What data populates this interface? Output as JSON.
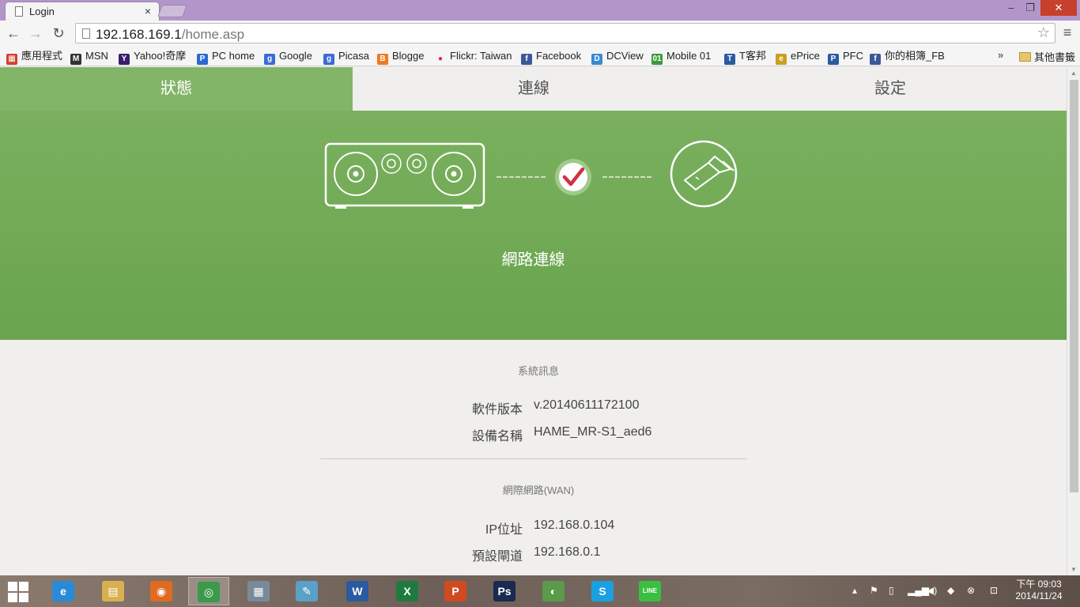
{
  "browser": {
    "tab_title": "Login",
    "tab_close": "×",
    "url_host": "192.168.169.1",
    "url_path": "/home.asp",
    "window_controls": {
      "minimize": "–",
      "restore": "❐",
      "close": "✕"
    },
    "nav": {
      "back": "←",
      "forward": "→",
      "reload": "↻",
      "star": "☆",
      "menu": "≡"
    },
    "bookmarks": [
      {
        "label": "應用程式",
        "icon": "apps-grid-icon",
        "color": "#d04030",
        "glyph": "▦"
      },
      {
        "label": "MSN",
        "icon": "msn-icon",
        "color": "#333333",
        "glyph": "M"
      },
      {
        "label": "Yahoo!奇摩",
        "icon": "yahoo-icon",
        "color": "#3b1e6b",
        "glyph": "Y"
      },
      {
        "label": "PC home",
        "icon": "pchome-icon",
        "color": "#2a6ad0",
        "glyph": "P"
      },
      {
        "label": "Google",
        "icon": "google-icon",
        "color": "#3b6bd6",
        "glyph": "g"
      },
      {
        "label": "Picasa",
        "icon": "picasa-icon",
        "color": "#3b6bd6",
        "glyph": "g"
      },
      {
        "label": "Blogge",
        "icon": "blogger-icon",
        "color": "#f07a20",
        "glyph": "B"
      },
      {
        "label": "Flickr: Taiwan",
        "icon": "flickr-icon",
        "color": "#ffffff",
        "glyph": "●"
      },
      {
        "label": "Facebook",
        "icon": "facebook-icon",
        "color": "#3b5998",
        "glyph": "f"
      },
      {
        "label": "DCView",
        "icon": "dcview-icon",
        "color": "#3a8ad0",
        "glyph": "D"
      },
      {
        "label": "Mobile 01",
        "icon": "mobile01-icon",
        "color": "#3a9a3a",
        "glyph": "01"
      },
      {
        "label": "T客邦",
        "icon": "tkebang-icon",
        "color": "#2a5aa0",
        "glyph": "T"
      },
      {
        "label": "ePrice",
        "icon": "eprice-icon",
        "color": "#c8a020",
        "glyph": "e"
      },
      {
        "label": "PFC",
        "icon": "pfc-icon",
        "color": "#2a5aa0",
        "glyph": "P"
      },
      {
        "label": "你的相簿_FB",
        "icon": "facebook-icon",
        "color": "#3b5998",
        "glyph": "f"
      }
    ],
    "bookmarks_overflow": "»",
    "other_bookmarks": "其他書籤"
  },
  "app": {
    "tabs": [
      {
        "label": "狀態",
        "active": true
      },
      {
        "label": "連線",
        "active": false
      },
      {
        "label": "設定",
        "active": false
      }
    ],
    "status_caption": "網路連線",
    "system_info": {
      "title": "系統訊息",
      "rows": [
        {
          "label": "軟件版本",
          "value": "v.20140611172100"
        },
        {
          "label": "設備名稱",
          "value": "HAME_MR-S1_aed6"
        }
      ]
    },
    "wan": {
      "title": "網際網路(WAN)",
      "rows": [
        {
          "label": "IP位址",
          "value": "192.168.0.104"
        },
        {
          "label": "預設閘道",
          "value": "192.168.0.1"
        }
      ]
    },
    "colors": {
      "accent": "#7ab05e",
      "tab_active": "#82b567",
      "check": "#d03040"
    }
  },
  "taskbar": {
    "apps": [
      {
        "name": "internet-explorer-icon",
        "glyph": "e",
        "color": "#2a8ad8"
      },
      {
        "name": "file-explorer-icon",
        "glyph": "▤",
        "color": "#d8b050"
      },
      {
        "name": "firefox-icon",
        "glyph": "◉",
        "color": "#e06a20"
      },
      {
        "name": "chrome-icon",
        "glyph": "◎",
        "color": "#3a9a4a"
      },
      {
        "name": "calculator-icon",
        "glyph": "▦",
        "color": "#7a8a9a"
      },
      {
        "name": "notes-icon",
        "glyph": "✎",
        "color": "#5aa0c8"
      },
      {
        "name": "word-icon",
        "glyph": "W",
        "color": "#2a5aa0"
      },
      {
        "name": "excel-icon",
        "glyph": "X",
        "color": "#207a40"
      },
      {
        "name": "powerpoint-icon",
        "glyph": "P",
        "color": "#d04a20"
      },
      {
        "name": "photoshop-icon",
        "glyph": "Ps",
        "color": "#1a2a50"
      },
      {
        "name": "green-app-icon",
        "glyph": "◐",
        "color": "#5a9a4a"
      },
      {
        "name": "skype-icon",
        "glyph": "S",
        "color": "#1aa0e0"
      },
      {
        "name": "line-icon",
        "glyph": "LINE",
        "color": "#3ac040"
      }
    ],
    "clock_period_time": "下午 09:03",
    "clock_date": "2014/11/24"
  }
}
